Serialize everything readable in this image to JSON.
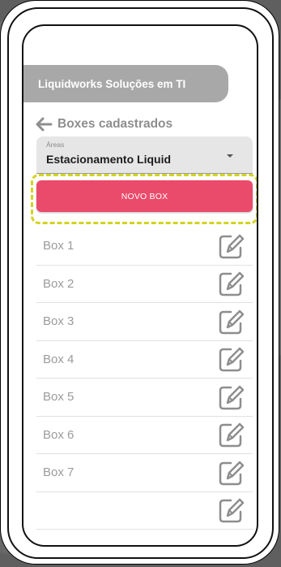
{
  "header": {
    "company": "Liquidworks Soluções em TI"
  },
  "page": {
    "title": "Boxes cadastrados"
  },
  "area_select": {
    "label": "Áreas",
    "value": "Estacionamento Liquid"
  },
  "new_box_button": {
    "label": "NOVO BOX"
  },
  "boxes": [
    {
      "label": "Box 1"
    },
    {
      "label": "Box 2"
    },
    {
      "label": "Box 3"
    },
    {
      "label": "Box 4"
    },
    {
      "label": "Box 5"
    },
    {
      "label": "Box 6"
    },
    {
      "label": "Box 7"
    },
    {
      "label": ""
    }
  ],
  "colors": {
    "accent": "#ea4b6a",
    "header_bg": "#a8a8a8",
    "highlight": "#d3d321",
    "icon": "#8e8e8e"
  },
  "icons": [
    "back-arrow-icon",
    "dropdown-caret-icon",
    "edit-icon"
  ]
}
